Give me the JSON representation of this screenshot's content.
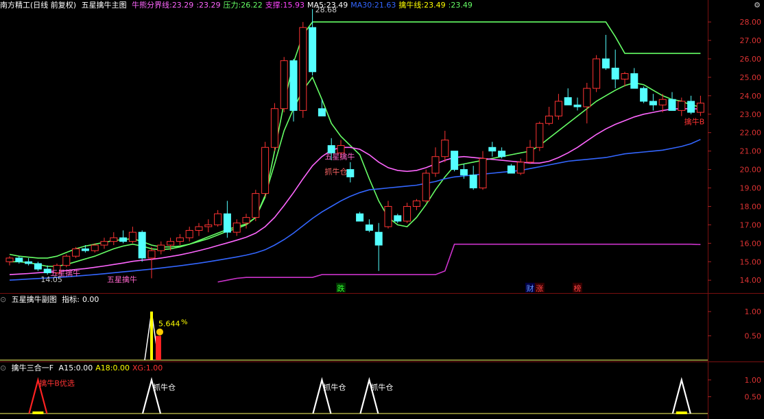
{
  "header": {
    "app": "南方精工(日线 前复权)",
    "indicator": "五星擒牛主图",
    "items": [
      {
        "label": "牛熊分界线:",
        "value": "23.29",
        "color": "#ff66ff"
      },
      {
        "label": ":",
        "value": "23.29",
        "color": "#ff66ff"
      },
      {
        "label": "压力:",
        "value": "26.22",
        "color": "#66ff66"
      },
      {
        "label": "支撑:",
        "value": "15.93",
        "color": "#ff44ff"
      },
      {
        "label": "MA5:",
        "value": "23.49",
        "color": "#ffffff"
      },
      {
        "label": "MA30:",
        "value": "21.63",
        "color": "#3366ff"
      },
      {
        "label": "擒牛线:",
        "value": "23.49",
        "color": "#ffff00"
      },
      {
        "label": ":",
        "value": "23.49",
        "color": "#66ff66"
      }
    ]
  },
  "sub_header": {
    "title": "五星擒牛副图",
    "label": "指标:",
    "value": "0.00"
  },
  "lower_header": {
    "title": "擒牛三合一F",
    "items": [
      {
        "label": "A15:",
        "value": "0.00",
        "color": "#ffffff"
      },
      {
        "label": "A18:",
        "value": "0.00",
        "color": "#ffff00"
      },
      {
        "label": "XG:",
        "value": "1.00",
        "color": "#ff3333"
      }
    ]
  },
  "chart_data": [
    {
      "type": "candlestick",
      "title": "五星擒牛主图",
      "ylim": [
        13.6,
        28.3
      ],
      "y_ticks": [
        "28.00",
        "27.00",
        "26.00",
        "25.00",
        "24.00",
        "23.00",
        "22.00",
        "21.00",
        "20.00",
        "19.00",
        "18.00",
        "17.00",
        "16.00",
        "15.00",
        "14.00"
      ],
      "candles": [
        [
          15.0,
          15.3,
          14.8,
          15.2
        ],
        [
          15.2,
          15.3,
          14.9,
          15.0
        ],
        [
          15.0,
          15.2,
          14.8,
          14.9
        ],
        [
          14.9,
          15.0,
          14.5,
          14.6
        ],
        [
          14.6,
          14.8,
          14.3,
          14.4
        ],
        [
          14.4,
          14.9,
          14.3,
          14.8
        ],
        [
          14.8,
          15.4,
          14.7,
          15.3
        ],
        [
          15.3,
          15.8,
          15.2,
          15.7
        ],
        [
          15.7,
          15.9,
          15.5,
          15.6
        ],
        [
          15.6,
          16.0,
          15.5,
          15.9
        ],
        [
          15.9,
          16.3,
          15.7,
          16.1
        ],
        [
          16.1,
          16.6,
          15.9,
          16.3
        ],
        [
          16.3,
          16.7,
          16.0,
          16.1
        ],
        [
          16.1,
          16.9,
          16.0,
          16.6
        ],
        [
          16.6,
          16.7,
          15.0,
          15.2
        ],
        [
          15.2,
          15.8,
          14.1,
          15.6
        ],
        [
          15.6,
          16.1,
          15.4,
          15.9
        ],
        [
          15.9,
          16.3,
          15.6,
          16.1
        ],
        [
          16.1,
          16.5,
          15.9,
          16.3
        ],
        [
          16.3,
          16.9,
          16.1,
          16.7
        ],
        [
          16.7,
          17.1,
          16.4,
          16.9
        ],
        [
          16.9,
          17.3,
          16.6,
          17.0
        ],
        [
          17.0,
          17.8,
          16.9,
          17.6
        ],
        [
          17.6,
          18.3,
          16.3,
          16.6
        ],
        [
          16.6,
          17.3,
          16.4,
          17.1
        ],
        [
          17.1,
          17.6,
          16.8,
          17.4
        ],
        [
          17.4,
          18.9,
          17.2,
          18.7
        ],
        [
          18.7,
          21.5,
          18.5,
          21.2
        ],
        [
          21.2,
          23.6,
          21.0,
          23.3
        ],
        [
          23.3,
          26.1,
          23.1,
          25.9
        ],
        [
          25.9,
          26.0,
          22.6,
          23.2
        ],
        [
          23.2,
          28.0,
          22.8,
          27.7
        ],
        [
          27.7,
          28.7,
          25.1,
          25.3
        ],
        [
          23.3,
          23.8,
          22.9,
          22.9
        ],
        [
          21.3,
          21.7,
          20.5,
          20.9
        ],
        [
          20.9,
          21.6,
          20.6,
          21.3
        ],
        [
          20.0,
          20.4,
          19.3,
          19.6
        ],
        [
          17.6,
          17.7,
          17.2,
          17.2
        ],
        [
          17.0,
          17.3,
          16.6,
          16.7
        ],
        [
          16.6,
          17.1,
          14.5,
          15.9
        ],
        [
          16.9,
          18.3,
          16.8,
          18.0
        ],
        [
          17.5,
          17.6,
          17.1,
          17.2
        ],
        [
          17.2,
          18.2,
          17.1,
          18.0
        ],
        [
          18.0,
          18.4,
          17.8,
          18.3
        ],
        [
          18.3,
          20.0,
          18.2,
          19.8
        ],
        [
          19.8,
          21.2,
          19.6,
          20.7
        ],
        [
          20.7,
          22.1,
          20.4,
          21.6
        ],
        [
          21.0,
          21.0,
          19.9,
          20.0
        ],
        [
          20.0,
          20.3,
          19.5,
          19.7
        ],
        [
          19.7,
          20.2,
          18.9,
          19.0
        ],
        [
          19.0,
          21.0,
          18.9,
          20.6
        ],
        [
          21.2,
          21.5,
          20.7,
          21.0
        ],
        [
          21.0,
          21.2,
          20.6,
          20.7
        ],
        [
          20.2,
          20.3,
          19.8,
          19.8
        ],
        [
          19.8,
          20.6,
          19.7,
          20.4
        ],
        [
          20.4,
          21.6,
          20.3,
          21.2
        ],
        [
          21.2,
          22.6,
          21.0,
          22.5
        ],
        [
          22.5,
          23.4,
          22.4,
          22.9
        ],
        [
          22.9,
          24.1,
          22.7,
          23.7
        ],
        [
          23.9,
          24.4,
          23.5,
          23.5
        ],
        [
          23.5,
          23.9,
          23.2,
          23.4
        ],
        [
          23.4,
          24.7,
          22.5,
          24.4
        ],
        [
          24.4,
          26.2,
          24.2,
          26.0
        ],
        [
          26.0,
          27.3,
          25.4,
          25.5
        ],
        [
          25.5,
          26.5,
          24.4,
          24.9
        ],
        [
          24.9,
          25.3,
          24.5,
          25.2
        ],
        [
          25.2,
          25.5,
          24.4,
          24.4
        ],
        [
          24.4,
          24.5,
          23.6,
          23.7
        ],
        [
          23.7,
          24.1,
          23.2,
          23.5
        ],
        [
          23.5,
          24.1,
          23.1,
          23.8
        ],
        [
          23.8,
          24.2,
          23.2,
          23.2
        ],
        [
          23.2,
          23.9,
          22.9,
          23.7
        ],
        [
          23.7,
          24.0,
          23.0,
          23.1
        ],
        [
          23.1,
          24.0,
          22.9,
          23.6
        ]
      ],
      "series": [
        {
          "name": "压力",
          "color": "#66ff66",
          "values": [
            15.4,
            15.3,
            15.25,
            15.2,
            15.2,
            15.3,
            15.5,
            15.7,
            15.85,
            15.95,
            16.05,
            16.15,
            16.2,
            16.25,
            16.1,
            15.9,
            15.8,
            15.8,
            15.85,
            15.95,
            16.1,
            16.25,
            16.45,
            16.65,
            16.8,
            17.0,
            17.4,
            18.5,
            21.0,
            23.6,
            25.8,
            27.3,
            28.0,
            28.0,
            28.0,
            28.0,
            28.0,
            28.0,
            28.0,
            28.0,
            28.0,
            28.0,
            28.0,
            28.0,
            28.0,
            28.0,
            28.0,
            28.0,
            28.0,
            28.0,
            28.0,
            28.0,
            28.0,
            28.0,
            28.0,
            28.0,
            28.0,
            28.0,
            28.0,
            28.0,
            28.0,
            28.0,
            28.0,
            28.0,
            27.2,
            26.3,
            26.3,
            26.3,
            26.3,
            26.3,
            26.3,
            26.3,
            26.3,
            26.3
          ]
        },
        {
          "name": "擒牛线",
          "color": "#66ff66",
          "values": [
            15.0,
            15.0,
            14.95,
            14.85,
            14.75,
            14.75,
            14.85,
            15.0,
            15.15,
            15.3,
            15.5,
            15.7,
            15.85,
            15.95,
            15.85,
            15.7,
            15.65,
            15.7,
            15.8,
            15.95,
            16.15,
            16.35,
            16.55,
            16.75,
            16.9,
            17.05,
            17.4,
            18.6,
            20.3,
            22.1,
            23.3,
            24.3,
            25.0,
            23.8,
            22.5,
            21.8,
            21.3,
            20.8,
            19.5,
            18.3,
            17.4,
            17.0,
            16.9,
            17.4,
            18.1,
            18.9,
            19.6,
            20.2,
            20.3,
            20.4,
            20.5,
            20.6,
            20.7,
            20.8,
            20.9,
            21.0,
            21.3,
            21.7,
            22.1,
            22.5,
            22.9,
            23.3,
            23.7,
            24.0,
            24.3,
            24.55,
            24.7,
            24.6,
            24.3,
            24.0,
            23.8,
            23.7,
            23.5,
            23.4
          ]
        },
        {
          "name": "牛熊分界线",
          "color": "#ff66ff",
          "values": [
            14.3,
            14.33,
            14.36,
            14.4,
            14.43,
            14.47,
            14.52,
            14.58,
            14.63,
            14.7,
            14.77,
            14.85,
            14.93,
            15.02,
            15.08,
            15.13,
            15.2,
            15.28,
            15.37,
            15.48,
            15.6,
            15.73,
            15.88,
            16.02,
            16.17,
            16.33,
            16.55,
            16.9,
            17.4,
            18.05,
            18.75,
            19.5,
            20.2,
            20.7,
            21.05,
            21.2,
            21.2,
            21.1,
            20.8,
            20.4,
            20.1,
            19.95,
            19.9,
            19.95,
            20.1,
            20.3,
            20.5,
            20.65,
            20.7,
            20.65,
            20.6,
            20.55,
            20.5,
            20.45,
            20.4,
            20.35,
            20.35,
            20.45,
            20.65,
            20.9,
            21.2,
            21.55,
            21.9,
            22.2,
            22.45,
            22.65,
            22.85,
            23.0,
            23.1,
            23.2,
            23.28,
            23.3,
            23.29,
            23.29
          ]
        },
        {
          "name": "MA30",
          "color": "#3366ff",
          "values": [
            14.0,
            14.03,
            14.06,
            14.09,
            14.12,
            14.15,
            14.18,
            14.22,
            14.26,
            14.3,
            14.35,
            14.4,
            14.45,
            14.5,
            14.55,
            14.6,
            14.66,
            14.72,
            14.78,
            14.85,
            14.92,
            15.0,
            15.08,
            15.17,
            15.26,
            15.36,
            15.48,
            15.65,
            15.9,
            16.2,
            16.55,
            16.95,
            17.35,
            17.7,
            18.0,
            18.3,
            18.55,
            18.75,
            18.9,
            18.95,
            19.0,
            19.05,
            19.1,
            19.15,
            19.25,
            19.35,
            19.5,
            19.6,
            19.65,
            19.7,
            19.75,
            19.8,
            19.85,
            19.9,
            19.95,
            20.05,
            20.15,
            20.25,
            20.35,
            20.45,
            20.5,
            20.55,
            20.6,
            20.65,
            20.75,
            20.85,
            20.9,
            20.95,
            21.0,
            21.05,
            21.15,
            21.25,
            21.4,
            21.63
          ]
        },
        {
          "name": "支撑",
          "color": "#cc33cc",
          "values": [
            null,
            null,
            null,
            null,
            null,
            null,
            null,
            null,
            null,
            null,
            null,
            null,
            null,
            null,
            null,
            null,
            null,
            null,
            null,
            null,
            null,
            null,
            13.9,
            14.0,
            14.1,
            14.15,
            14.15,
            14.15,
            14.15,
            14.15,
            14.15,
            14.15,
            14.15,
            14.3,
            14.3,
            14.3,
            14.3,
            14.3,
            14.3,
            14.3,
            14.3,
            14.3,
            14.3,
            14.3,
            14.3,
            14.3,
            14.5,
            15.95,
            15.95,
            15.95,
            15.95,
            15.95,
            15.95,
            15.95,
            15.95,
            15.95,
            15.95,
            15.95,
            15.95,
            15.95,
            15.95,
            15.95,
            15.95,
            15.95,
            15.95,
            15.95,
            15.95,
            15.95,
            15.95,
            15.95,
            15.95,
            15.95,
            15.95,
            15.93
          ]
        }
      ],
      "annotations": [
        {
          "text": "28.68",
          "at": 32,
          "value": 28.68,
          "color": "#cccccc"
        },
        {
          "text": "14.05",
          "at": 3,
          "value": 14.05,
          "color": "#cccccc"
        },
        {
          "text": "五星擒牛",
          "at": 4,
          "value": 14.4,
          "color": "#ff66cc"
        },
        {
          "text": "五星擒牛",
          "at": 10,
          "value": 14.05,
          "color": "#ff66cc"
        },
        {
          "text": "五星擒牛",
          "at": 33,
          "value": 20.7,
          "color": "#ff66cc"
        },
        {
          "text": "抓牛仓",
          "at": 33,
          "value": 19.9,
          "color": "#ff6666"
        },
        {
          "text": "擒牛B",
          "at": 71,
          "value": 22.6,
          "color": "#ff3333"
        }
      ],
      "markers": [
        {
          "text": "跌",
          "at": 35,
          "bg": "#003300",
          "color": "#33ff33"
        },
        {
          "text": "财",
          "at": 55,
          "bg": "#000044",
          "color": "#6699ff"
        },
        {
          "text": "涨",
          "at": 56,
          "bg": "#330000",
          "color": "#ff4444"
        },
        {
          "text": "榜",
          "at": 60,
          "bg": "#330000",
          "color": "#ff4444"
        }
      ]
    },
    {
      "type": "bar",
      "title": "五星擒牛副图",
      "ylim": [
        0,
        1.1
      ],
      "y_ticks": [
        "1.00",
        "0.50"
      ],
      "annotations": [
        {
          "text": "5.644",
          "color": "#ffff00"
        },
        {
          "text": "%",
          "color": "#ffff00"
        }
      ],
      "values": {
        "spike_at": 15,
        "value": 1.0
      }
    },
    {
      "type": "line",
      "title": "擒牛三合一F",
      "ylim": [
        0,
        1.1
      ],
      "y_ticks": [
        "1.00",
        "0.50"
      ],
      "annotations": [
        {
          "text": "擒牛B优选",
          "at": 3,
          "color": "#ff3333"
        },
        {
          "text": "抓牛仓",
          "at": 15,
          "color": "#ffffff"
        },
        {
          "text": "抓牛仓",
          "at": 33,
          "color": "#ffffff"
        },
        {
          "text": "抓牛仓",
          "at": 38,
          "color": "#ffffff"
        }
      ],
      "spikes": [
        {
          "at": 3,
          "color": "#ff2222"
        },
        {
          "at": 15,
          "color": "#ffffff"
        },
        {
          "at": 33,
          "color": "#ffffff"
        },
        {
          "at": 38,
          "color": "#ffffff"
        },
        {
          "at": 71,
          "color": "#ffffff"
        }
      ]
    }
  ]
}
